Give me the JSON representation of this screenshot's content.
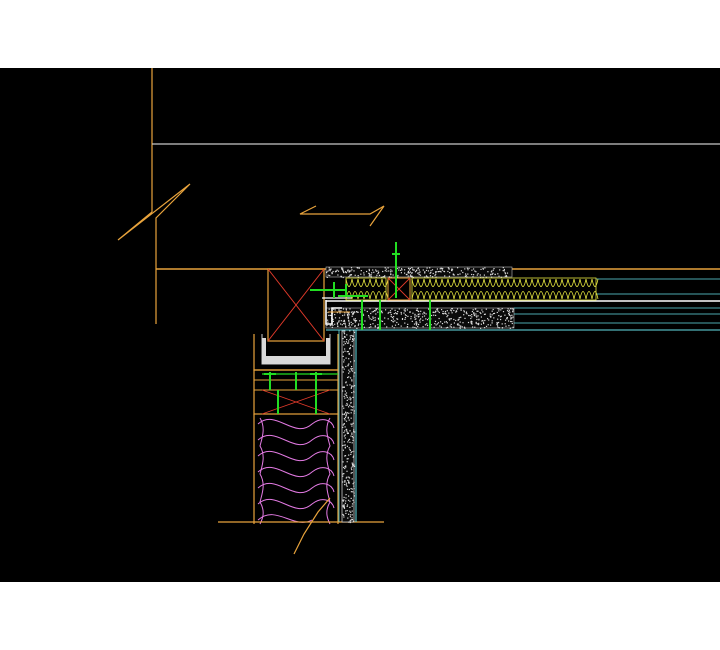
{
  "drawing": {
    "kind": "CAD section detail",
    "background": "#000000",
    "page_background": "#ffffff",
    "colors": {
      "structure": "#e8a33c",
      "ceiling_line": "#c8c8c8",
      "timber_cross": "#e03a2a",
      "fastener": "#22dd22",
      "board_fill": "#e8e8e8",
      "insulation_batt": "#e6e640",
      "insulation_wall": "#e37ae3",
      "membrane": "#66e0e8",
      "white": "#ffffff"
    },
    "elements": [
      "break-line-top",
      "break-line-bottom",
      "ceiling-line",
      "floor-line",
      "top-plate-timber",
      "sill-channel",
      "wall-insulation",
      "ceiling-boards",
      "ceiling-insulation",
      "wall-lining",
      "fasteners"
    ]
  }
}
